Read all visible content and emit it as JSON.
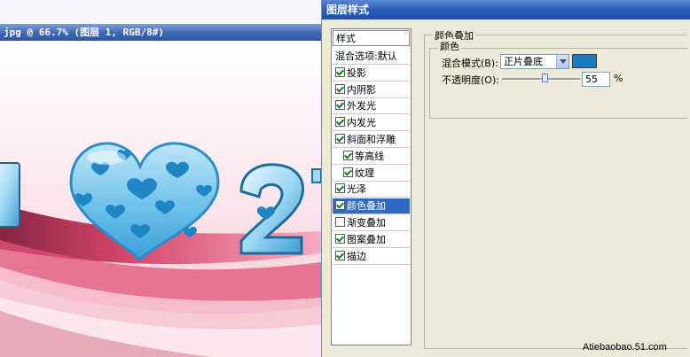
{
  "document": {
    "title": "jpg @ 66.7% (图层 1, RGB/8#)",
    "artwork_text_left": "I",
    "artwork_text_right": "2"
  },
  "dialog": {
    "title": "图层样式",
    "styles_list": {
      "header": "样式",
      "items": [
        {
          "label": "混合选项:默认",
          "checkbox": false,
          "checked": false,
          "indent": false,
          "selected": false
        },
        {
          "label": "投影",
          "checkbox": true,
          "checked": true,
          "indent": false,
          "selected": false
        },
        {
          "label": "内阴影",
          "checkbox": true,
          "checked": true,
          "indent": false,
          "selected": false
        },
        {
          "label": "外发光",
          "checkbox": true,
          "checked": true,
          "indent": false,
          "selected": false
        },
        {
          "label": "内发光",
          "checkbox": true,
          "checked": true,
          "indent": false,
          "selected": false
        },
        {
          "label": "斜面和浮雕",
          "checkbox": true,
          "checked": true,
          "indent": false,
          "selected": false
        },
        {
          "label": "等高线",
          "checkbox": true,
          "checked": true,
          "indent": true,
          "selected": false
        },
        {
          "label": "纹理",
          "checkbox": true,
          "checked": true,
          "indent": true,
          "selected": false
        },
        {
          "label": "光泽",
          "checkbox": true,
          "checked": true,
          "indent": false,
          "selected": false
        },
        {
          "label": "颜色叠加",
          "checkbox": true,
          "checked": true,
          "indent": false,
          "selected": true
        },
        {
          "label": "渐变叠加",
          "checkbox": true,
          "checked": false,
          "indent": false,
          "selected": false
        },
        {
          "label": "图案叠加",
          "checkbox": true,
          "checked": true,
          "indent": false,
          "selected": false
        },
        {
          "label": "描边",
          "checkbox": true,
          "checked": true,
          "indent": false,
          "selected": false
        }
      ]
    },
    "color_overlay": {
      "group_title": "颜色叠加",
      "subgroup_title": "颜色",
      "blend_mode_label": "混合模式(B):",
      "blend_mode_value": "正片叠底",
      "swatch_color": "#1a7cc0",
      "opacity_label": "不透明度(O):",
      "opacity_value": "55",
      "opacity_unit": "%",
      "opacity_fraction": 0.55
    }
  },
  "watermark": "Atiebaobao.51.com",
  "colors": {
    "heart_fill": "#5fb9e6",
    "heart_dots": "#1f86c4",
    "selection": "#316ac5"
  }
}
